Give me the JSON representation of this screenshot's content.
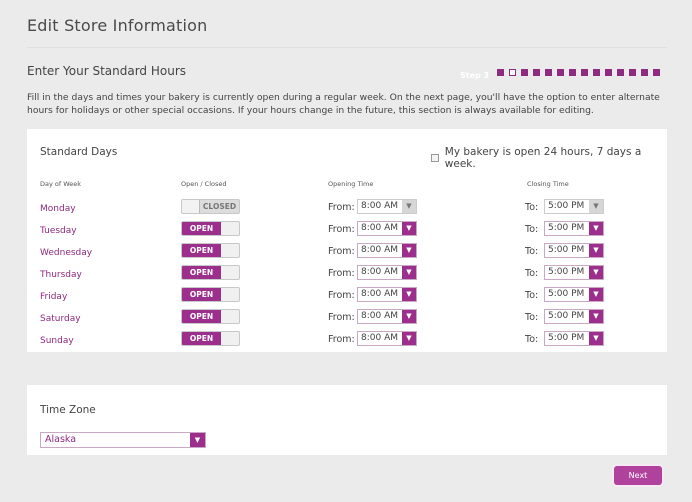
{
  "page": {
    "title": "Edit Store Information",
    "section_heading": "Enter Your Standard Hours",
    "step_label": "Step 3",
    "step_total": 14,
    "step_current": 2,
    "intro": "Fill in the days and times your bakery is currently open during a regular week. On the next page, you'll have the option to enter alternate hours for holidays or other special occasions. If your hours change in the future, this section is always available for editing."
  },
  "hours": {
    "title": "Standard Days",
    "all_day_label": "My bakery is open 24 hours, 7 days a week.",
    "all_day_checked": false,
    "columns": {
      "day": "Day of Week",
      "status": "Open / Closed",
      "opening": "Opening Time",
      "closing": "Closing Time"
    },
    "from_label": "From:",
    "to_label": "To:",
    "days": [
      {
        "name": "Monday",
        "status": "CLOSED",
        "open": "8:00 AM",
        "close": "5:00 PM"
      },
      {
        "name": "Tuesday",
        "status": "OPEN",
        "open": "8:00 AM",
        "close": "5:00 PM"
      },
      {
        "name": "Wednesday",
        "status": "OPEN",
        "open": "8:00 AM",
        "close": "5:00 PM"
      },
      {
        "name": "Thursday",
        "status": "OPEN",
        "open": "8:00 AM",
        "close": "5:00 PM"
      },
      {
        "name": "Friday",
        "status": "OPEN",
        "open": "8:00 AM",
        "close": "5:00 PM"
      },
      {
        "name": "Saturday",
        "status": "OPEN",
        "open": "8:00 AM",
        "close": "5:00 PM"
      },
      {
        "name": "Sunday",
        "status": "OPEN",
        "open": "8:00 AM",
        "close": "5:00 PM"
      }
    ]
  },
  "timezone": {
    "title": "Time Zone",
    "selected": "Alaska"
  },
  "actions": {
    "next_label": "Next"
  },
  "colors": {
    "accent": "#9c2f8c",
    "background": "#ebebeb",
    "panel": "#ffffff"
  }
}
